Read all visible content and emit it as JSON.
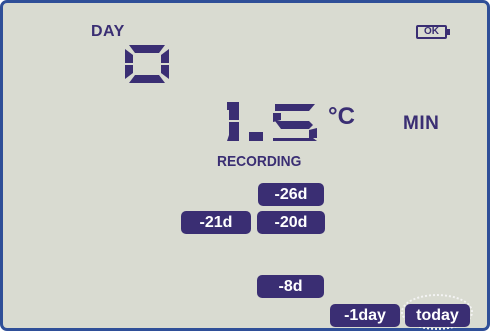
{
  "display": {
    "day_label": "DAY",
    "day_value": "0",
    "battery_status": "OK",
    "temperature": "1.5",
    "unit": "°C",
    "stat_mode": "MIN",
    "status_text": "RECORDING"
  },
  "history_buttons": [
    {
      "label": "-26d"
    },
    {
      "label": "-21d"
    },
    {
      "label": "-20d"
    },
    {
      "label": "-8d"
    },
    {
      "label": "-1day"
    },
    {
      "label": "today"
    }
  ],
  "colors": {
    "segment": "#3a2e73",
    "lcd_background": "#d9dbd1",
    "frame": "#2f4f98",
    "pill_text": "#ffffff"
  },
  "icons": [
    "battery-ok-icon"
  ]
}
